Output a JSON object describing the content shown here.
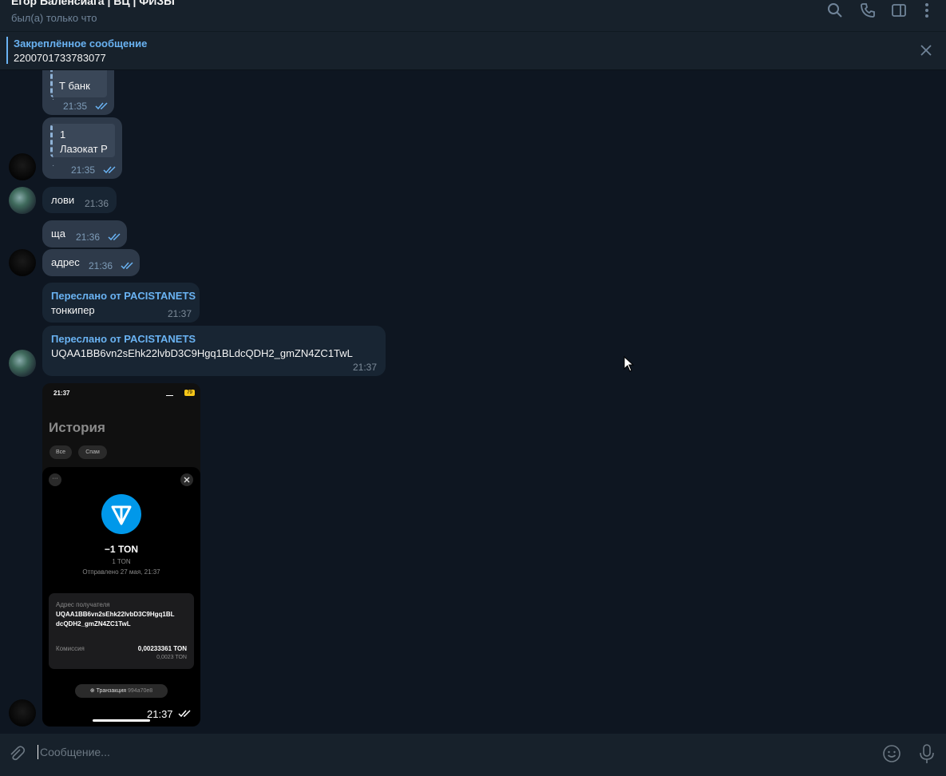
{
  "header": {
    "title": "Егор Баленсиага | ВЦ | ФИЗЫ",
    "status": "был(а) только что"
  },
  "pinned": {
    "title": "Закреплённое сообщение",
    "text": "2200701733783077"
  },
  "messages": {
    "m1": {
      "quote": "Т банк",
      "time": "21:35"
    },
    "m2": {
      "quote_line1": "1",
      "quote_line2": "Лазокат Р",
      "time": "21:35"
    },
    "m3": {
      "text": "лови",
      "time": "21:36"
    },
    "m4": {
      "text": "ща",
      "time": "21:36"
    },
    "m5": {
      "text": "адрес",
      "time": "21:36"
    },
    "m6": {
      "forwarded": "Переслано от PACISTANETS",
      "text": "тонкипер",
      "time": "21:37"
    },
    "m7": {
      "forwarded": "Переслано от PACISTANETS",
      "text": "UQAA1BB6vn2sEhk22lvbD3C9Hgq1BLdcQDH2_gmZN4ZC1TwL",
      "time": "21:37"
    },
    "m8": {
      "time": "21:37"
    }
  },
  "screenshot": {
    "status_time": "21:37",
    "battery": "79",
    "history_title": "История",
    "tab_all": "Все",
    "tab_spam": "Спам",
    "more": "···",
    "amount": "−1 TON",
    "amount_sub": "1 TON",
    "sent": "Отправлено 27 мая, 21:37",
    "recipient_label": "Адрес получателя",
    "recipient_line1": "UQAA1BB6vn2sEhk22lvbD3C9Hgq1BL",
    "recipient_line2": "dcQDH2_gmZN4ZC1TwL",
    "fee_label": "Комиссия",
    "fee_value": "0,00233361 TON",
    "fee_sub": "0,0023 TON",
    "tx_label": "Транзакция",
    "tx_hash": "994a70e8"
  },
  "composer": {
    "placeholder": "Сообщение..."
  },
  "colors": {
    "accent": "#6ab3f3",
    "ton": "#0098ea",
    "background": "#0e1621"
  }
}
